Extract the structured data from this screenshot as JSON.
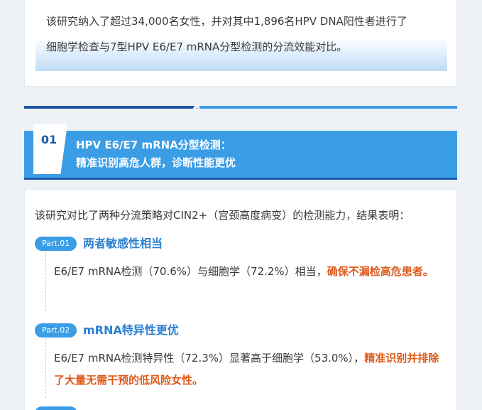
{
  "intro": {
    "line1": "该研究纳入了超过34,000名女性，并对其中1,896名HPV DNA阳性者进行了",
    "line2": "细胞学检查与7型HPV E6/E7 mRNA分型检测的分流效能对比。"
  },
  "section": {
    "number": "01",
    "title_line1": "HPV E6/E7 mRNA分型检测：",
    "title_line2": "精准识别高危人群，诊断性能更优"
  },
  "lead": "该研究对比了两种分流策略对CIN2+（宫颈高度病变）的检测能力，结果表明：",
  "parts": [
    {
      "tag": "Part.01",
      "heading": "两者敏感性相当",
      "body_plain": "E6/E7 mRNA检测（70.6%）与细胞学（72.2%）相当，",
      "body_highlight": "确保不漏检高危患者。"
    },
    {
      "tag": "Part.02",
      "heading": "mRNA特异性更优",
      "body_plain": "E6/E7 mRNA检测特异性（72.3%）显著高于细胞学（53.0%），",
      "body_highlight": "精准识别并排除了大量无需干预的低风险女性。"
    }
  ],
  "colors": {
    "primary_blue": "#3a9de6",
    "dark_blue": "#1f5aa8",
    "highlight_orange": "#e05a1a",
    "heading_blue": "#2a7fd0"
  }
}
